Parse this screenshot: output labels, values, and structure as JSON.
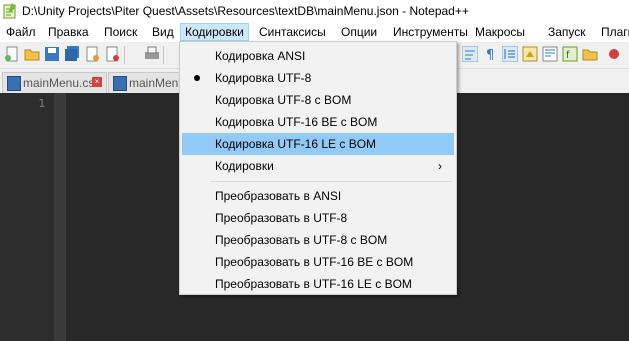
{
  "window": {
    "title": "D:\\Unity Projects\\Piter Quest\\Assets\\Resources\\textDB\\mainMenu.json - Notepad++"
  },
  "menubar": {
    "items": [
      "Файл",
      "Правка",
      "Поиск",
      "Вид",
      "Кодировки",
      "Синтаксисы",
      "Опции",
      "Инструменты",
      "Макросы",
      "Запуск",
      "Плаги"
    ]
  },
  "tabs": [
    {
      "label": "mainMenu.cs"
    },
    {
      "label": "mainMenu.c"
    }
  ],
  "editor": {
    "line_numbers": [
      "1"
    ],
    "theme_bg": "#282828"
  },
  "encoding_menu": {
    "items": [
      {
        "label": "Кодировка ANSI",
        "checked": false
      },
      {
        "label": "Кодировка UTF-8",
        "checked": true
      },
      {
        "label": "Кодировка UTF-8 с BOM",
        "checked": false
      },
      {
        "label": "Кодировка UTF-16 BE с BOM",
        "checked": false
      },
      {
        "label": "Кодировка UTF-16 LE с BOM",
        "checked": false,
        "highlighted": true
      },
      {
        "label": "Кодировки",
        "submenu": true,
        "arrow": "›"
      },
      {
        "label": "Преобразовать в ANSI"
      },
      {
        "label": "Преобразовать в UTF-8"
      },
      {
        "label": "Преобразовать в UTF-8 с BOM"
      },
      {
        "label": "Преобразовать в UTF-16 BE с BOM"
      },
      {
        "label": "Преобразовать в UTF-16 LE с BOM"
      }
    ],
    "highlight_color": "#91c9f7"
  }
}
